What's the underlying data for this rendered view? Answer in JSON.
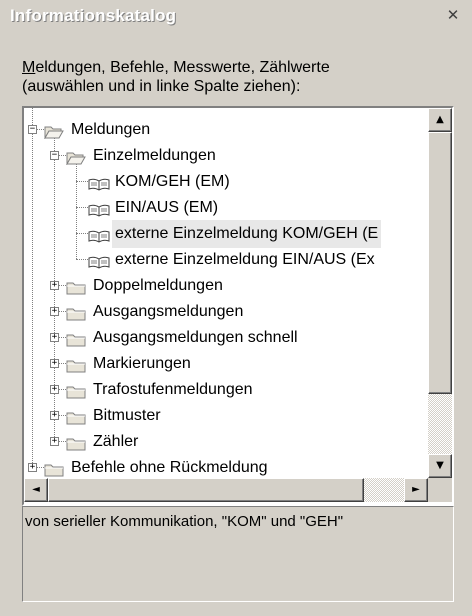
{
  "window": {
    "title": "Informationskatalog",
    "close_glyph": "✕"
  },
  "hint": {
    "mnemonic": "M",
    "line1_rest": "eldungen, Befehle, Messwerte, Zählwerte",
    "line2": "(auswählen und in linke Spalte ziehen):"
  },
  "tree": [
    {
      "label": "Meldungen",
      "level": 0,
      "expander": "−",
      "icon": "folder-open-icon"
    },
    {
      "label": "Einzelmeldungen",
      "level": 1,
      "expander": "−",
      "icon": "folder-open-icon"
    },
    {
      "label": "KOM/GEH (EM)",
      "level": 2,
      "expander": "",
      "icon": "book-icon"
    },
    {
      "label": "EIN/AUS (EM)",
      "level": 2,
      "expander": "",
      "icon": "book-icon"
    },
    {
      "label": "externe Einzelmeldung KOM/GEH (E",
      "level": 2,
      "expander": "",
      "icon": "book-icon",
      "selected": true
    },
    {
      "label": "externe Einzelmeldung EIN/AUS (Ex",
      "level": 2,
      "expander": "",
      "icon": "book-icon"
    },
    {
      "label": "Doppelmeldungen",
      "level": 1,
      "expander": "+",
      "icon": "folder-icon"
    },
    {
      "label": "Ausgangsmeldungen",
      "level": 1,
      "expander": "+",
      "icon": "folder-icon"
    },
    {
      "label": "Ausgangsmeldungen schnell",
      "level": 1,
      "expander": "+",
      "icon": "folder-icon"
    },
    {
      "label": "Markierungen",
      "level": 1,
      "expander": "+",
      "icon": "folder-icon"
    },
    {
      "label": "Trafostufenmeldungen",
      "level": 1,
      "expander": "+",
      "icon": "folder-icon"
    },
    {
      "label": "Bitmuster",
      "level": 1,
      "expander": "+",
      "icon": "folder-icon"
    },
    {
      "label": "Zähler",
      "level": 1,
      "expander": "+",
      "icon": "folder-icon"
    },
    {
      "label": "Befehle ohne Rückmeldung",
      "level": 0,
      "expander": "+",
      "icon": "folder-icon"
    }
  ],
  "scroll": {
    "up": "▲",
    "down": "▼",
    "left": "◄",
    "right": "►"
  },
  "description": "von serieller Kommunikation, \"KOM\" und \"GEH\""
}
